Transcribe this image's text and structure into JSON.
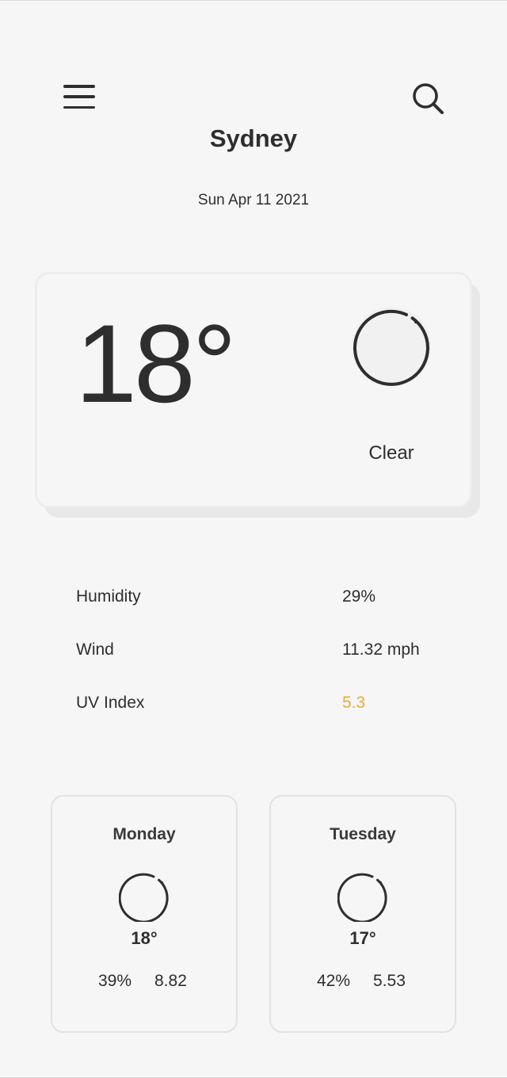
{
  "header": {
    "menu_icon": "hamburger-menu-icon",
    "search_icon": "search-icon",
    "city": "Sydney",
    "date": "Sun Apr 11 2021"
  },
  "current": {
    "temperature": "18°",
    "condition": "Clear",
    "icon": "clear-sky-circle-icon"
  },
  "details": [
    {
      "label": "Humidity",
      "value": "29%"
    },
    {
      "label": "Wind",
      "value": "11.32 mph"
    },
    {
      "label": "UV Index",
      "value": "5.3"
    }
  ],
  "forecast": [
    {
      "day": "Monday",
      "temp": "18°",
      "humidity": "39%",
      "wind": "8.82",
      "icon": "clear-sky-circle-icon"
    },
    {
      "day": "Tuesday",
      "temp": "17°",
      "humidity": "42%",
      "wind": "5.53",
      "icon": "clear-sky-circle-icon"
    }
  ],
  "colors": {
    "background": "#f6f6f6",
    "text": "#2e2e2e",
    "uv_accent": "#f0a830",
    "card_border": "#e2e2e2"
  }
}
